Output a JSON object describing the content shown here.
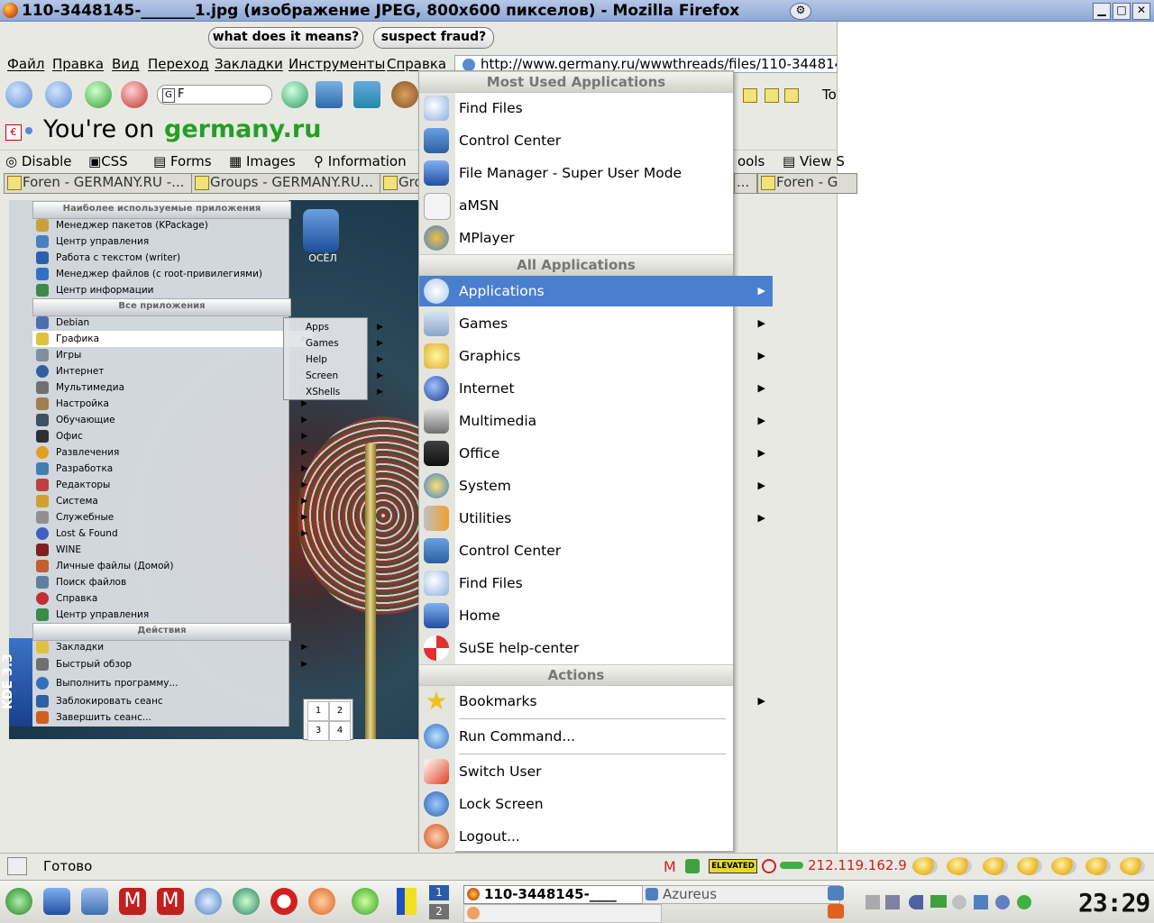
{
  "window": {
    "title": "110-3448145-_______1.jpg (изображение JPEG, 800x600 пикселов) - Mozilla Firefox"
  },
  "page_buttons": {
    "what": "what does it means?",
    "fraud": "suspect fraud?"
  },
  "menubar": [
    "Файл",
    "Правка",
    "Вид",
    "Переход",
    "Закладки",
    "Инструменты",
    "Справка"
  ],
  "url": "http://www.germany.ru/wwwthreads/files/110-344814",
  "search_value": "F",
  "toolbar_right_text": "To",
  "germany_bar": {
    "prefix": "You're on",
    "site": "germany.ru"
  },
  "webdev_bar": {
    "left": [
      "Disable",
      "CSS",
      "Forms",
      "Images",
      "Information"
    ],
    "right": [
      "ools",
      "View S"
    ]
  },
  "tabs": [
    "Foren - GERMANY.RU -...",
    "Groups - GERMANY.RU...",
    "Gro",
    "...",
    "Foren - G"
  ],
  "kde_small": {
    "head_most": "Наиболее используемые приложения",
    "most": [
      "Менеджер пакетов (KPackage)",
      "Центр управления",
      "Работа с текстом (writer)",
      "Менеджер файлов (с root-привилегиями)",
      "Центр информации"
    ],
    "head_all": "Все приложения",
    "all": [
      "Debian",
      "Графика",
      "Игры",
      "Интернет",
      "Мультимедиа",
      "Настройка",
      "Обучающие",
      "Офис",
      "Развлечения",
      "Разработка",
      "Редакторы",
      "Система",
      "Служебные",
      "Lost & Found",
      "WINE",
      "Личные файлы (Домой)",
      "Поиск файлов",
      "Справка",
      "Центр управления"
    ],
    "head_actions": "Действия",
    "actions": [
      "Закладки",
      "Быстрый обзор",
      "Выполнить программу...",
      "Заблокировать сеанс",
      "Завершить сеанс..."
    ],
    "side": "KDE 3.3",
    "submenu": [
      "Apps",
      "Games",
      "Help",
      "Screen",
      "XShells"
    ],
    "desktop_icon": "ОСЁЛ",
    "pager": [
      "1",
      "2",
      "3",
      "4"
    ]
  },
  "kde_main": {
    "head_most": "Most Used Applications",
    "most": [
      "Find Files",
      "Control Center",
      "File Manager - Super User Mode",
      "aMSN",
      "MPlayer"
    ],
    "head_all": "All Applications",
    "all": [
      "Applications",
      "Games",
      "Graphics",
      "Internet",
      "Multimedia",
      "Office",
      "System",
      "Utilities",
      "Control Center",
      "Find Files",
      "Home",
      "SuSE help-center"
    ],
    "head_actions": "Actions",
    "actions": [
      "Bookmarks",
      "Run Command...",
      "Switch User",
      "Lock Screen",
      "Logout..."
    ]
  },
  "statusbar": {
    "text": "Готово",
    "elevated": "ELEVATED",
    "ip": "212.119.162.9"
  },
  "taskbar": {
    "desks": [
      "1",
      "2"
    ],
    "tasks": [
      "110-3448145-____",
      "Azureus"
    ],
    "clock": "23:29"
  }
}
